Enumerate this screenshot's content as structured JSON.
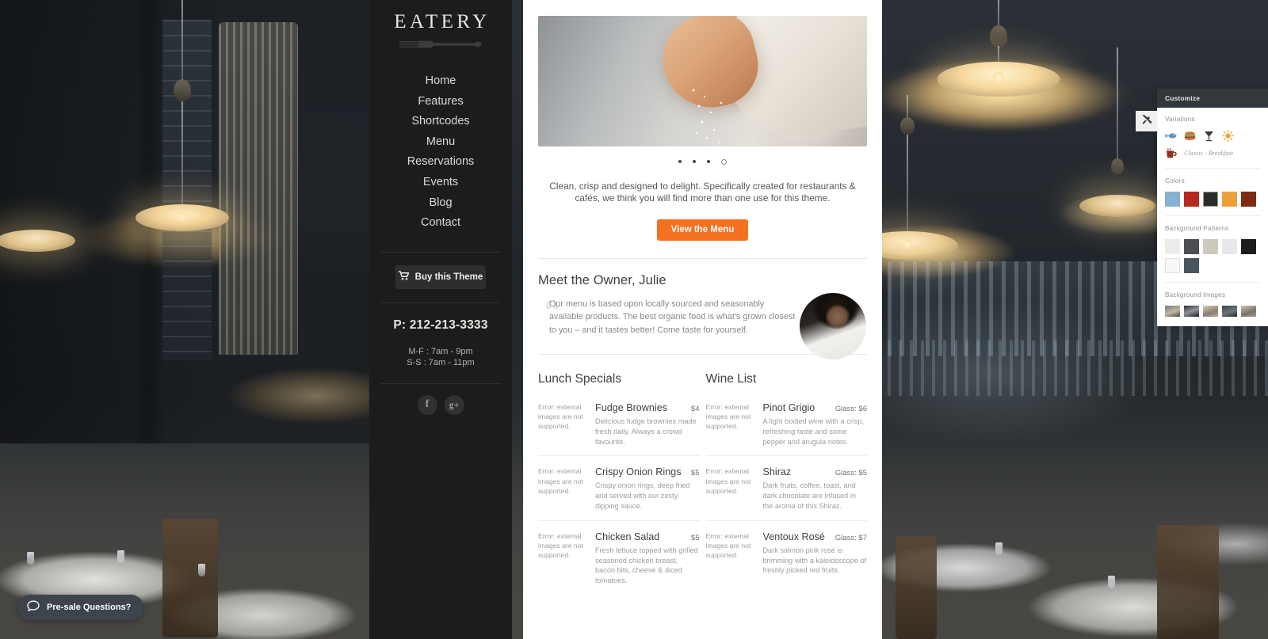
{
  "site": {
    "logo_text": "EATERY",
    "logo_icon": "fork-icon"
  },
  "nav": {
    "items": [
      {
        "label": "Home"
      },
      {
        "label": "Features"
      },
      {
        "label": "Shortcodes"
      },
      {
        "label": "Menu"
      },
      {
        "label": "Reservations"
      },
      {
        "label": "Events"
      },
      {
        "label": "Blog"
      },
      {
        "label": "Contact"
      }
    ]
  },
  "sidebar": {
    "buy_button": {
      "label": "Buy this Theme",
      "icon": "shopping-cart-icon"
    },
    "phone": "P: 212-213-3333",
    "hours": {
      "weekday": "M-F : 7am - 9pm",
      "weekend": "S-S : 7am - 11pm"
    },
    "socials": [
      {
        "name": "facebook-icon",
        "glyph": "f"
      },
      {
        "name": "google-plus-icon",
        "glyph": "g+"
      }
    ]
  },
  "hero": {
    "image_alt": "hand sprinkling salt",
    "carousel_dots": 4,
    "active_dot": 4
  },
  "intro": {
    "tagline": "Clean, crisp and designed to delight. Specifically created for restaurants & cafés, we think you will find more than one use for this theme.",
    "cta_label": "View the Menu",
    "cta_color": "#f4711f"
  },
  "owner": {
    "heading": "Meet the Owner, Julie",
    "quote": "Our menu is based upon locally sourced and seasonably available products. The best organic food is what's grown closest to you – and it tastes better! Come taste for yourself.",
    "photo_alt": "chef portrait"
  },
  "image_error_text": "Error: external images are not supported.",
  "menus": [
    {
      "title": "Lunch Specials",
      "items": [
        {
          "name": "Fudge Brownies",
          "price": "$4",
          "description": "Delicious fudge brownies made fresh daily. Always a crowd favourite."
        },
        {
          "name": "Crispy Onion Rings",
          "price": "$5",
          "description": "Crispy onion rings, deep fried and served with our zesty dipping sauce."
        },
        {
          "name": "Chicken Salad",
          "price": "$5",
          "description": "Fresh lettuce topped with grilled seasoned chicken breast, bacon bits, cheese & diced tomatoes."
        }
      ]
    },
    {
      "title": "Wine List",
      "items": [
        {
          "name": "Pinot Grigio",
          "price": "Glass: $6",
          "description": "A light bodied wine with a crisp, refreshing taste and some pepper and arugula notes."
        },
        {
          "name": "Shiraz",
          "price": "Glass: $5",
          "description": "Dark fruits, coffee, toast, and dark chocolate are infused in the aroma of this Shiraz."
        },
        {
          "name": "Ventoux Rosé",
          "price": "Glass: $7",
          "description": "Dark salmon pink rosé is brimming with a kaleidoscope of freshly picked red fruits."
        }
      ]
    }
  ],
  "customize": {
    "header": "Customize",
    "toggle_icon": "tools-icon",
    "sections": {
      "variations": {
        "title": "Variations",
        "icons": [
          {
            "name": "fish-icon",
            "color": "#5b93c4"
          },
          {
            "name": "burger-icon",
            "color": "#c0502a"
          },
          {
            "name": "cocktail-glass-icon",
            "color": "#3a3a3a"
          },
          {
            "name": "sun-icon",
            "color": "#f0a030"
          },
          {
            "name": "coffee-cup-icon",
            "color": "#8a3a1c"
          }
        ],
        "selected_label": "Classic - Breakfast"
      },
      "colors": {
        "title": "Colors",
        "swatches": [
          "#86b0d4",
          "#b6291f",
          "#2b2b2b",
          "#eda03a",
          "#7d2c11"
        ]
      },
      "background_patterns": {
        "title": "Background Patterns",
        "swatches": [
          "#ececea",
          "#4a4f53",
          "#cfc8bd",
          "#e6e8ea",
          "#1d1d1d",
          "#f7f7f7",
          "#4a545c"
        ]
      },
      "background_images": {
        "title": "Background Images",
        "count": 5
      }
    }
  },
  "help_widget": {
    "label": "Pre-sale Questions?",
    "icon": "chat-bubble-icon"
  }
}
